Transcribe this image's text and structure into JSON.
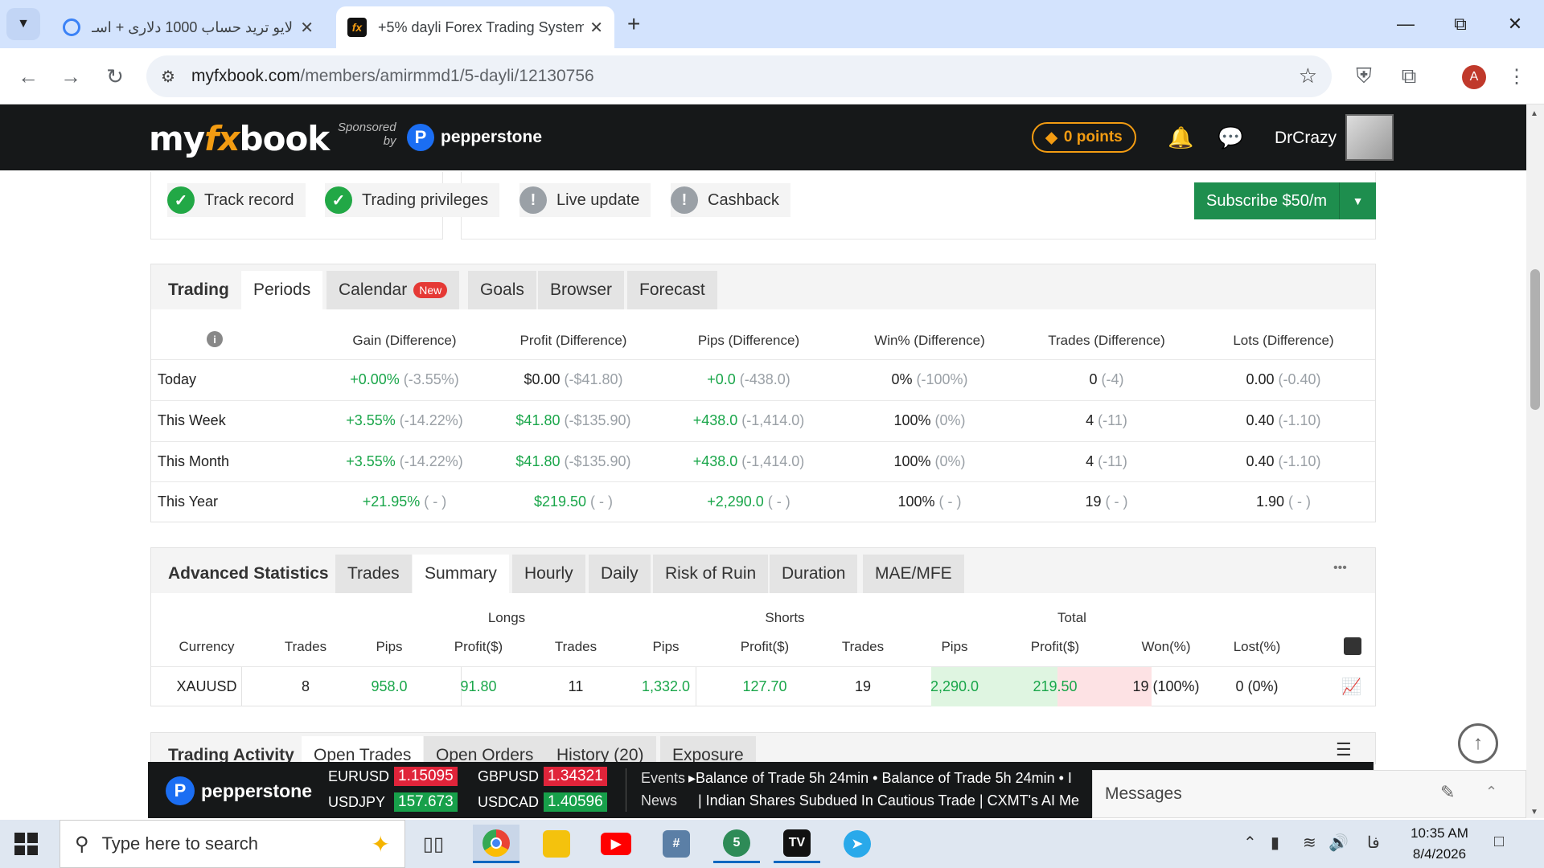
{
  "browser": {
    "tabs": [
      {
        "title": "لایو ترید حساب 1000 دلاری + اسـ",
        "active": false
      },
      {
        "title": "+5% dayli Forex Trading System",
        "active": true
      }
    ],
    "new_tab": "+",
    "url_host": "myfxbook.com",
    "url_path": "/members/amirmmd1/5-dayli/12130756",
    "profile_initial": "A"
  },
  "site": {
    "logo_my": "my",
    "logo_fx": "fx",
    "logo_book": "book",
    "sponsored_line1": "Sponsored",
    "sponsored_line2": "by",
    "sponsor_name": "pepperstone",
    "points": "0 points",
    "username": "DrCrazy"
  },
  "badges": [
    {
      "label": "Track record",
      "status": "ok"
    },
    {
      "label": "Trading privileges",
      "status": "ok"
    },
    {
      "label": "Live update",
      "status": "warn"
    },
    {
      "label": "Cashback",
      "status": "warn"
    }
  ],
  "subscribe_label": "Subscribe $50/m",
  "periods": {
    "tabs": [
      "Trading",
      "Periods",
      "Calendar",
      "Goals",
      "Browser",
      "Forecast"
    ],
    "new_badge": "New",
    "columns": [
      "Gain (Difference)",
      "Profit (Difference)",
      "Pips (Difference)",
      "Win% (Difference)",
      "Trades (Difference)",
      "Lots (Difference)"
    ],
    "rows": [
      {
        "label": "Today",
        "cells": [
          [
            "+0.00%",
            "(-3.55%)"
          ],
          [
            "$0.00",
            "(-$41.80)"
          ],
          [
            "+0.0",
            "(-438.0)"
          ],
          [
            "0%",
            "(-100%)"
          ],
          [
            "0",
            "(-4)"
          ],
          [
            "0.00",
            "(-0.40)"
          ]
        ]
      },
      {
        "label": "This Week",
        "cells": [
          [
            "+3.55%",
            "(-14.22%)"
          ],
          [
            "$41.80",
            "(-$135.90)"
          ],
          [
            "+438.0",
            "(-1,414.0)"
          ],
          [
            "100%",
            "(0%)"
          ],
          [
            "4",
            "(-11)"
          ],
          [
            "0.40",
            "(-1.10)"
          ]
        ]
      },
      {
        "label": "This Month",
        "cells": [
          [
            "+3.55%",
            "(-14.22%)"
          ],
          [
            "$41.80",
            "(-$135.90)"
          ],
          [
            "+438.0",
            "(-1,414.0)"
          ],
          [
            "100%",
            "(0%)"
          ],
          [
            "4",
            "(-11)"
          ],
          [
            "0.40",
            "(-1.10)"
          ]
        ]
      },
      {
        "label": "This Year",
        "cells": [
          [
            "+21.95%",
            "( - )"
          ],
          [
            "$219.50",
            "( - )"
          ],
          [
            "+2,290.0",
            "( - )"
          ],
          [
            "100%",
            "( - )"
          ],
          [
            "19",
            "( - )"
          ],
          [
            "1.90",
            "( - )"
          ]
        ]
      }
    ]
  },
  "advanced": {
    "tabs": [
      "Advanced Statistics",
      "Trades",
      "Summary",
      "Hourly",
      "Daily",
      "Risk of Ruin",
      "Duration",
      "MAE/MFE"
    ],
    "more": "•••",
    "groups": [
      "Longs",
      "Shorts",
      "Total"
    ],
    "columns": [
      "Currency",
      "Trades",
      "Pips",
      "Profit($)",
      "Trades",
      "Pips",
      "Profit($)",
      "Trades",
      "Pips",
      "Profit($)",
      "Won(%)",
      "Lost(%)"
    ],
    "row": [
      "XAUUSD",
      "8",
      "958.0",
      "91.80",
      "11",
      "1,332.0",
      "127.70",
      "19",
      "2,290.0",
      "219.50",
      "19 (100%)",
      "0 (0%)"
    ]
  },
  "activity": {
    "tabs": [
      "Trading Activity",
      "Open Trades",
      "Open Orders",
      "History (20)",
      "Exposure"
    ]
  },
  "ticker": {
    "brand": "pepperstone",
    "quotes": [
      {
        "sym": "EURUSD",
        "val": "1.15095",
        "dir": "down"
      },
      {
        "sym": "GBPUSD",
        "val": "1.34321",
        "dir": "down"
      },
      {
        "sym": "USDJPY",
        "val": "157.673",
        "dir": "up"
      },
      {
        "sym": "USDCAD",
        "val": "1.40596",
        "dir": "up"
      }
    ],
    "events_label": "Events",
    "news_label": "News",
    "events_line": "▸Balance of Trade  5h 24min   • Balance of Trade  5h 24min   • I",
    "news_line": "|   Indian Shares Subdued In Cautious Trade   |   CXMT's AI Me"
  },
  "messages_label": "Messages",
  "taskbar": {
    "search_placeholder": "Type here to search",
    "time": "10:35 AM",
    "date": "8/4/2026",
    "lang": "فا"
  }
}
